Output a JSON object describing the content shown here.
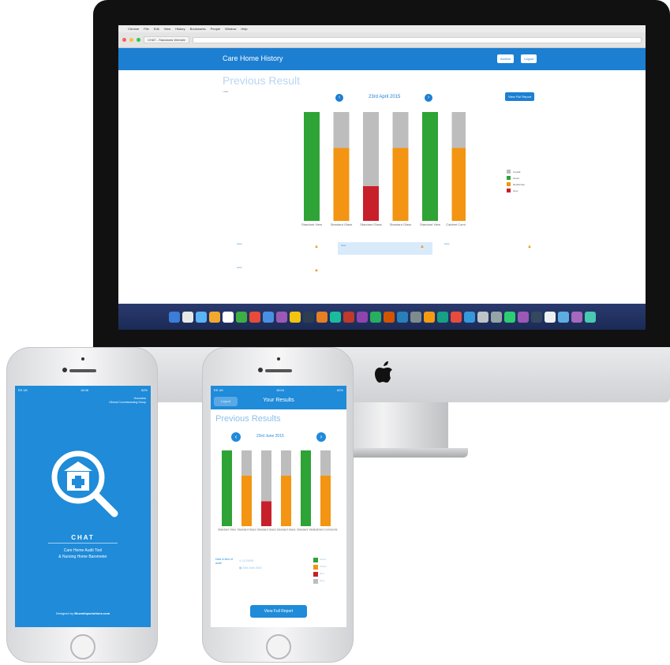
{
  "desktop": {
    "menubar": [
      "Chrome",
      "File",
      "Edit",
      "View",
      "History",
      "Bookmarks",
      "People",
      "Window",
      "Help"
    ],
    "tab_label": "CHAT - Standards Website",
    "app_title": "Care Home History",
    "header_buttons": [
      "Archive",
      "Logout"
    ],
    "page_heading": "Previous Result",
    "date": "23rd April 2015",
    "view_full_report": "View Full Report",
    "legend": [
      "Crystal",
      "Green",
      "Red/Amber",
      "Grey"
    ],
    "chart_data": {
      "type": "bar",
      "categories": [
        "Standard View",
        "Standard Glass",
        "Standard Glass",
        "Standard Glass",
        "Standard View",
        "Cabinet Comments"
      ],
      "series": [
        {
          "name": "Green",
          "values": [
            100,
            0,
            0,
            0,
            100,
            0
          ]
        },
        {
          "name": "Red",
          "values": [
            0,
            0,
            32,
            0,
            0,
            0
          ]
        },
        {
          "name": "Amber",
          "values": [
            0,
            67,
            0,
            67,
            0,
            67
          ]
        },
        {
          "name": "Grey",
          "values": [
            0,
            33,
            68,
            33,
            0,
            33
          ]
        }
      ],
      "colors": {
        "green": "#2ea336",
        "amber": "#f39412",
        "red": "#c7202a",
        "grey": "#bdbdbd"
      },
      "ylim": [
        0,
        100
      ]
    }
  },
  "phone1": {
    "carrier": "EE UK",
    "time": "16:06",
    "battery": "62%",
    "org_line1": "Hounslow",
    "org_line2": "Clinical Commissioning Group",
    "app_name": "CHAT",
    "subtitle_line1": "Care Home Audit Tool",
    "subtitle_line2": "& Nursing Home Barometer",
    "footer_prefix": "Designed by ",
    "footer_brand": "Bluewhipsolutions.com"
  },
  "phone2": {
    "carrier": "EE UK",
    "time": "16:04",
    "battery": "62%",
    "logout": "Logout",
    "title": "Your Results",
    "heading": "Previous Results",
    "date": "23rd June 2015",
    "meta_label": "Date & time of audit",
    "meta_time": "12:24PM",
    "meta_date": "23rd June 2015",
    "legend": [
      "Green",
      "Amber",
      "Red",
      "Grey"
    ],
    "view_full_report": "View Full Report",
    "chart_data": {
      "type": "bar",
      "categories": [
        "Standard View",
        "Standard Glass",
        "Standard Glass",
        "Standard Glass",
        "Standard View",
        "Cabinet Comments"
      ],
      "series": [
        {
          "name": "Green",
          "values": [
            100,
            0,
            0,
            0,
            100,
            0
          ]
        },
        {
          "name": "Red",
          "values": [
            0,
            0,
            33,
            0,
            0,
            0
          ]
        },
        {
          "name": "Amber",
          "values": [
            0,
            67,
            0,
            67,
            0,
            67
          ]
        },
        {
          "name": "Grey",
          "values": [
            0,
            33,
            67,
            33,
            0,
            33
          ]
        }
      ],
      "colors": {
        "green": "#2ea336",
        "amber": "#f39412",
        "red": "#c7202a",
        "grey": "#bdbdbd"
      },
      "ylim": [
        0,
        100
      ]
    }
  }
}
